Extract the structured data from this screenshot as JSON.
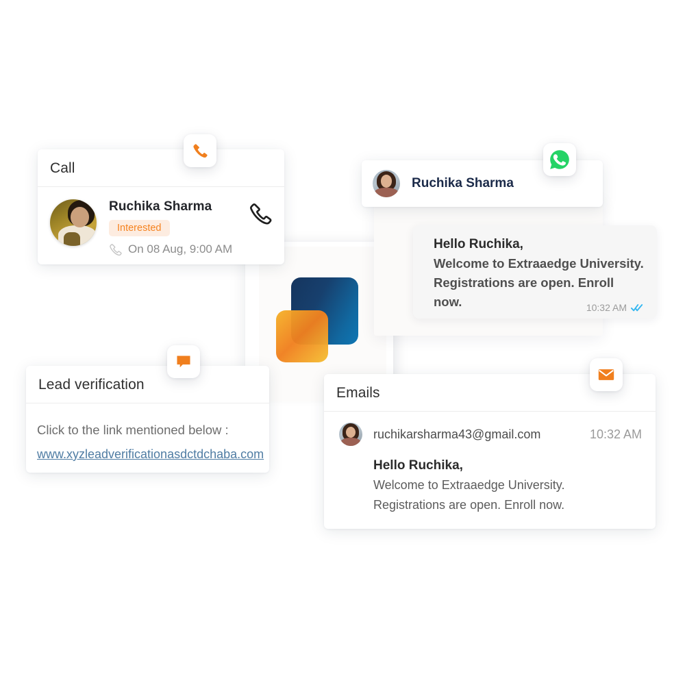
{
  "logo": {
    "name": "extraaedge-logo",
    "blue": "#16355e",
    "orange": "#f07f1e"
  },
  "call": {
    "title": "Call",
    "badge_icon": "phone-icon",
    "contact_name": "Ruchika Sharma",
    "status": "Interested",
    "status_color": "#f5821f",
    "status_bg": "#fdece0",
    "schedule": "On 08 Aug, 9:00 AM",
    "schedule_icon": "phone-outline-icon",
    "action_icon": "phone-call-icon",
    "avatar": "contact-avatar"
  },
  "whatsapp": {
    "badge_icon": "whatsapp-icon",
    "badge_color": "#25d366",
    "contact_name": "Ruchika Sharma",
    "avatar": "contact-avatar",
    "message": {
      "line1": "Hello Ruchika,",
      "line2": "Welcome to Extraaedge University.",
      "line3": "Registrations are  open. Enroll now.",
      "time": "10:32 AM",
      "read_icon": "double-check-icon",
      "read_color": "#34b7f1"
    }
  },
  "lead_verification": {
    "title": "Lead verification",
    "badge_icon": "chat-bubble-icon",
    "instruction": "Click to the link mentioned below :",
    "link": "www.xyzleadverificationasdctdchaba.com",
    "link_color": "#4f7ca3"
  },
  "emails": {
    "title": "Emails",
    "badge_icon": "envelope-icon",
    "badge_color": "#f5821f",
    "sender": "ruchikarsharma43@gmail.com",
    "time": "10:32 AM",
    "avatar": "contact-avatar",
    "message": {
      "line1": "Hello Ruchika,",
      "line2": "Welcome to Extraaedge University.",
      "line3": "Registrations are  open. Enroll now."
    }
  }
}
